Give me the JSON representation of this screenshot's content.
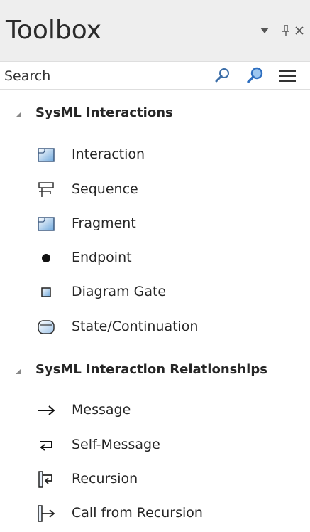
{
  "panel": {
    "title": "Toolbox"
  },
  "search": {
    "placeholder": "Search",
    "value": ""
  },
  "groups": [
    {
      "label": "SysML Interactions",
      "items": [
        {
          "label": "Interaction",
          "icon": "interaction-icon"
        },
        {
          "label": "Sequence",
          "icon": "sequence-icon"
        },
        {
          "label": "Fragment",
          "icon": "fragment-icon"
        },
        {
          "label": "Endpoint",
          "icon": "endpoint-icon"
        },
        {
          "label": "Diagram Gate",
          "icon": "diagram-gate-icon"
        },
        {
          "label": "State/Continuation",
          "icon": "state-continuation-icon"
        }
      ]
    },
    {
      "label": "SysML Interaction Relationships",
      "items": [
        {
          "label": "Message",
          "icon": "message-arrow-icon"
        },
        {
          "label": "Self-Message",
          "icon": "self-message-icon"
        },
        {
          "label": "Recursion",
          "icon": "recursion-icon"
        },
        {
          "label": "Call from Recursion",
          "icon": "call-from-recursion-icon"
        }
      ]
    }
  ]
}
